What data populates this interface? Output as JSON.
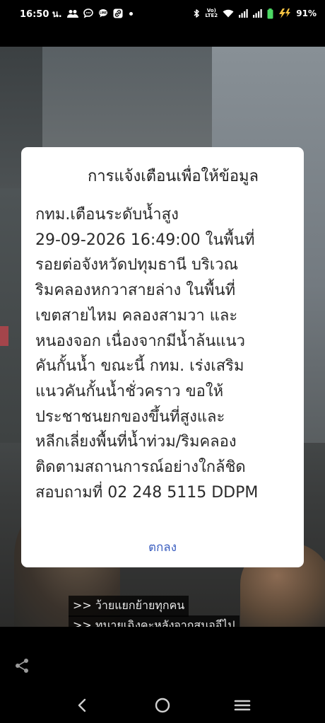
{
  "status_bar": {
    "time": "16:50 น.",
    "volte_label": "Vo) LTE2",
    "battery_percent": "91%"
  },
  "dialog": {
    "title": "การแจ้งเตือนเพื่อให้ข้อมูล",
    "body_lines": [
      "กทม.เตือนระดับน้ำสูง",
      "29-09-2026 16:49:00 ในพื้นที่",
      "รอยต่อจังหวัดปทุมธานี บริเวณ",
      "ริมคลองหกวาสายล่าง ในพื้นที่",
      "เขตสายไหม คลองสามวา และ",
      "หนองจอก เนื่องจากมีน้ำล้นแนว",
      "คันกั้นน้ำ ขณะนี้ กทม. เร่งเสริม",
      "แนวคันกั้นน้ำชั่วคราว ขอให้",
      "ประชาชนยกของขึ้นที่สูงและ",
      "หลีกเลี่ยงพื้นที่น้ำท่วม/ริมคลอง",
      "ติดตามสถานการณ์อย่างใกล้ชิด",
      "สอบถามที่ 02 248 5115 DDPM"
    ],
    "ok_label": "ตกลง"
  },
  "captions": [
    ">> ว้ายแยกย้ายทุกคน",
    ">> ทนายเฉิงคะหลังจากสนออีไป"
  ],
  "icons": {
    "share": "share-icon",
    "back": "back-icon",
    "home": "home-icon",
    "recents": "recents-icon"
  },
  "colors": {
    "dialog_button": "#3c5fc0",
    "battery": "#4cd964"
  }
}
